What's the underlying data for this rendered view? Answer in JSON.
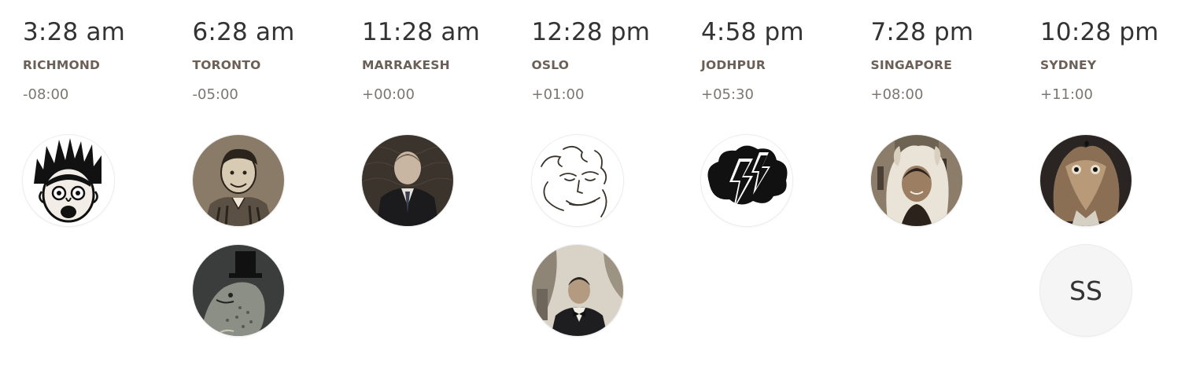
{
  "zones": [
    {
      "time": "3:28 am",
      "city": "RICHMOND",
      "offset": "-08:00",
      "members": [
        {
          "avatar": "spiky-hair-cartoon-face"
        }
      ]
    },
    {
      "time": "6:28 am",
      "city": "TORONTO",
      "offset": "-05:00",
      "members": [
        {
          "avatar": "sketched-man-portrait"
        },
        {
          "avatar": "top-hat-fish-illustration"
        }
      ]
    },
    {
      "time": "11:28 am",
      "city": "MARRAKESH",
      "offset": "+00:00",
      "members": [
        {
          "avatar": "man-in-suit-photo"
        }
      ]
    },
    {
      "time": "12:28 pm",
      "city": "OSLO",
      "offset": "+01:00",
      "members": [
        {
          "avatar": "line-drawing-face"
        },
        {
          "avatar": "man-in-bowtie-photo"
        }
      ]
    },
    {
      "time": "4:58 pm",
      "city": "JODHPUR",
      "offset": "+05:30",
      "members": [
        {
          "avatar": "lightning-cloud-logo"
        }
      ]
    },
    {
      "time": "7:28 pm",
      "city": "SINGAPORE",
      "offset": "+08:00",
      "members": [
        {
          "avatar": "person-in-furry-hood-photo"
        }
      ]
    },
    {
      "time": "10:28 pm",
      "city": "SYDNEY",
      "offset": "+11:00",
      "members": [
        {
          "avatar": "furry-creature-photo"
        },
        {
          "avatar": "initials-avatar",
          "initials": "SS"
        }
      ]
    }
  ]
}
